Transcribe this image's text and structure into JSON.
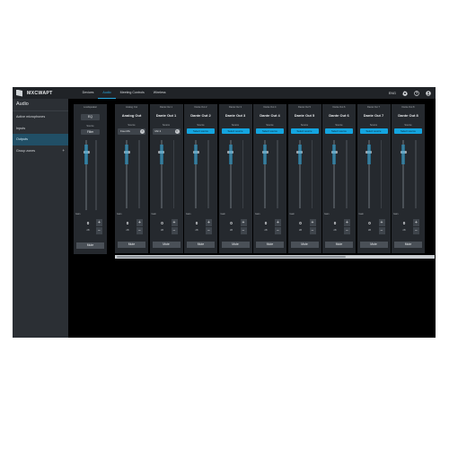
{
  "app": {
    "brand": "MXCWAPT"
  },
  "topnav": {
    "tabs": [
      {
        "label": "Devices",
        "active": false
      },
      {
        "label": "Audio",
        "active": true
      },
      {
        "label": "Meeting Controls",
        "active": false
      },
      {
        "label": "Wireless",
        "active": false
      }
    ],
    "language": "ENG",
    "icons": [
      "gear-icon",
      "help-icon",
      "account-icon"
    ]
  },
  "sidebar": {
    "title": "Audio",
    "items": [
      {
        "label": "Active microphones",
        "active": false
      },
      {
        "label": "Inputs",
        "active": false
      },
      {
        "label": "Outputs",
        "active": true
      },
      {
        "label": "Group zones",
        "active": false,
        "expand": "+"
      }
    ]
  },
  "loudspeaker": {
    "caption": "Loudspeaker",
    "eq_label": "EQ",
    "source_caption": "Source",
    "source_value": "Filter",
    "gain_caption": "Gain",
    "gain_value": "0",
    "gain_unit": "dB",
    "plus": "+",
    "minus": "−",
    "mute_label": "Mute"
  },
  "outputs": {
    "source_caption": "Source",
    "gain_caption": "Gain",
    "gain_unit": "dB",
    "plus": "+",
    "minus": "−",
    "mute_label": "Mute",
    "clear_icon": "×",
    "channels": [
      {
        "caption": "Analog Out",
        "name": "Analog Out",
        "source": "Free Mix",
        "source_type": "selected",
        "gain": "0"
      },
      {
        "caption": "Dante Out 1",
        "name": "Dante Out 1",
        "source": "Mic 2",
        "source_type": "selected",
        "gain": "0"
      },
      {
        "caption": "Dante Out 2",
        "name": "Dante Out 2",
        "source": "Select source",
        "source_type": "button",
        "gain": "0"
      },
      {
        "caption": "Dante Out 3",
        "name": "Dante Out 3",
        "source": "Select source",
        "source_type": "button",
        "gain": "0"
      },
      {
        "caption": "Dante Out 4",
        "name": "Dante Out 4",
        "source": "Select source",
        "source_type": "button",
        "gain": "0"
      },
      {
        "caption": "Dante Out 5",
        "name": "Dante Out 5",
        "source": "Select source",
        "source_type": "button",
        "gain": "0"
      },
      {
        "caption": "Dante Out 6",
        "name": "Dante Out 6",
        "source": "Select source",
        "source_type": "button",
        "gain": "0"
      },
      {
        "caption": "Dante Out 7",
        "name": "Dante Out 7",
        "source": "Select source",
        "source_type": "button",
        "gain": "0"
      },
      {
        "caption": "Dante Out 8",
        "name": "Dante Out 8",
        "source": "Select source",
        "source_type": "button",
        "gain": "0"
      }
    ]
  },
  "colors": {
    "accent": "#14a5e0",
    "sidebar_active": "#214f66",
    "strip_bg": "#25292e"
  }
}
